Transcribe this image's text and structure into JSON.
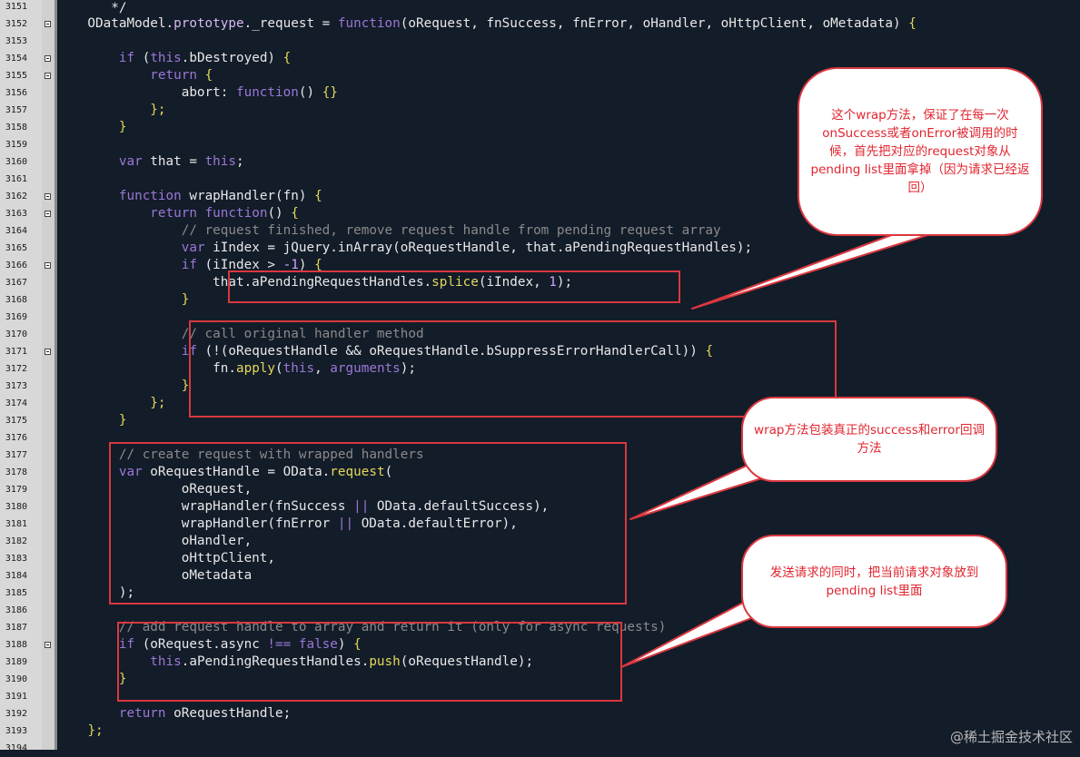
{
  "editor": {
    "line_numbers": [
      "3151",
      "3152",
      "3153",
      "3154",
      "3155",
      "3156",
      "3157",
      "3158",
      "3159",
      "3160",
      "3161",
      "3162",
      "3163",
      "3164",
      "3165",
      "3166",
      "3167",
      "3168",
      "3169",
      "3170",
      "3171",
      "3172",
      "3173",
      "3174",
      "3175",
      "3176",
      "3177",
      "3178",
      "3179",
      "3180",
      "3181",
      "3182",
      "3183",
      "3184",
      "3185",
      "3186",
      "3187",
      "3188",
      "3189",
      "3190",
      "3191",
      "3192",
      "3193",
      "3194"
    ],
    "fold_marker_lines": [
      "3152",
      "3154",
      "3155",
      "3162",
      "3163",
      "3166",
      "3171",
      "3188"
    ]
  },
  "annotations": {
    "bubble1": "这个wrap方法，保证了在每一次onSuccess或者onError被调用的时候，首先把对应的request对象从pending list里面拿掉（因为请求已经返回）",
    "bubble2": "wrap方法包装真正的success和error回调方法",
    "bubble3": "发送请求的同时，把当前请求对象放到pending list里面"
  },
  "watermark": "@稀土掘金技术社区",
  "colors": {
    "highlight_box": "#d9383f",
    "background": "#131c29",
    "keyword": "#9a78d6",
    "function_name": "#e2d85a",
    "comment": "#8a8a8a"
  }
}
